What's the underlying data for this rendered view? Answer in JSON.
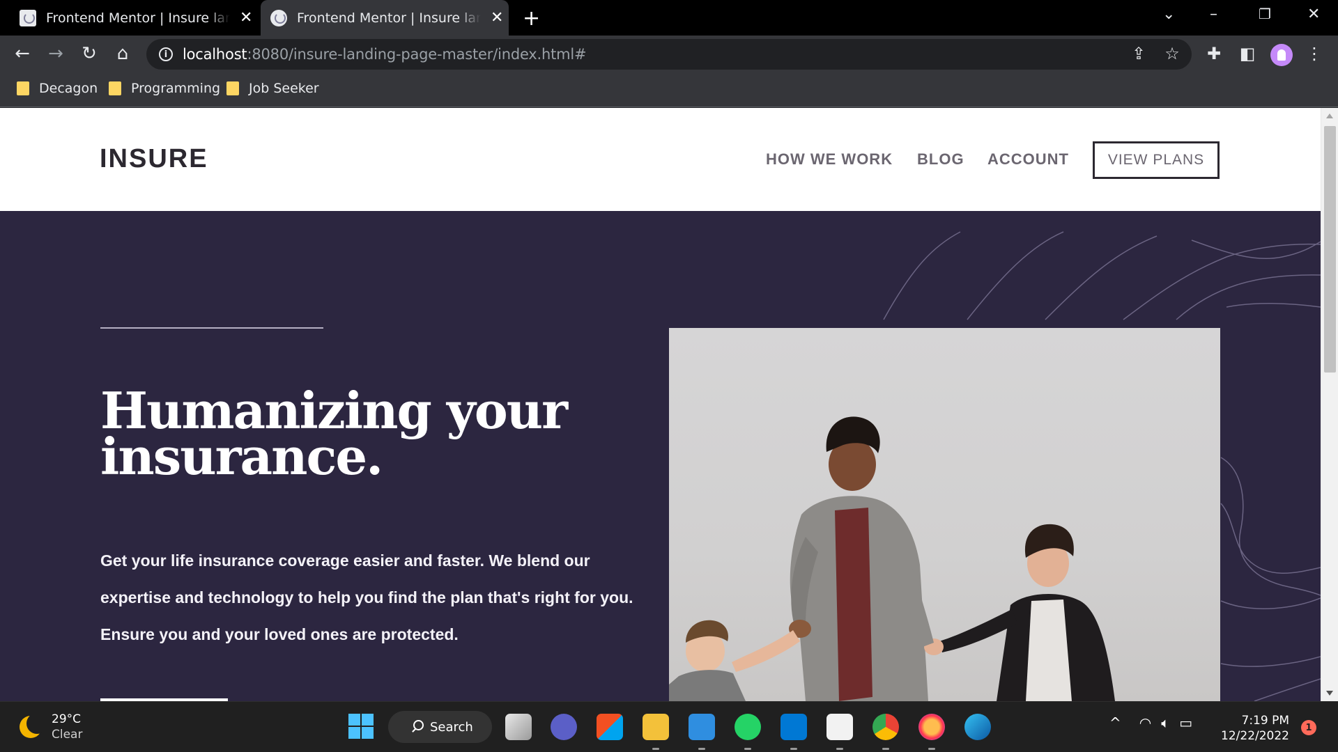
{
  "browser": {
    "tabs": [
      {
        "title": "Frontend Mentor | Insure landing page",
        "active": false
      },
      {
        "title": "Frontend Mentor | Insure landing page",
        "active": true
      }
    ],
    "url_host": "localhost",
    "url_rest": ":8080/insure-landing-page-master/index.html#",
    "bookmarks": [
      "Decagon",
      "Programming",
      "Job Seeker"
    ]
  },
  "site": {
    "logo": "INSURE",
    "nav": {
      "how_we_work": "HOW WE WORK",
      "blog": "BLOG",
      "account": "ACCOUNT",
      "view_plans": "VIEW PLANS"
    },
    "hero": {
      "title": "Humanizing your insurance.",
      "text": "Get your life insurance coverage easier and faster. We blend our expertise and technology to help you find the plan that's right for you. Ensure you and your loved ones are protected."
    }
  },
  "taskbar": {
    "weather_temp": "29°C",
    "weather_condition": "Clear",
    "search_label": "Search",
    "time": "7:19 PM",
    "date": "12/22/2022",
    "notification_count": "1"
  },
  "colors": {
    "hero_background": "#2c2640",
    "header_background": "#ffffff",
    "dark_text": "#2c2830",
    "nav_text": "#6b6670"
  }
}
